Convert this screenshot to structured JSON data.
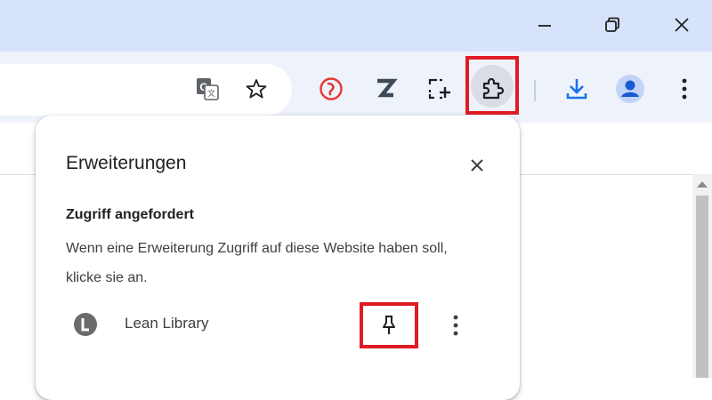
{
  "window": {
    "controls": [
      {
        "name": "minimize",
        "icon": "minimize-icon"
      },
      {
        "name": "restore",
        "icon": "restore-icon"
      },
      {
        "name": "close",
        "icon": "close-icon"
      }
    ]
  },
  "toolbar": {
    "icons": [
      "translate-icon",
      "bookmark-star-icon",
      "red-extension-icon",
      "z-extension-icon",
      "screenshot-extension-icon",
      "extensions-puzzle-icon",
      "download-icon",
      "profile-avatar-icon",
      "more-menu-icon"
    ]
  },
  "popup": {
    "title": "Erweiterungen",
    "section_heading": "Zugriff angefordert",
    "section_text": "Wenn eine Erweiterung Zugriff auf diese Website haben soll, klicke sie an.",
    "extensions": [
      {
        "name": "Lean Library",
        "icon": "lean-library-icon"
      }
    ]
  },
  "colors": {
    "titlebar": "#d7e3fb",
    "toolbar": "#eef2fa",
    "highlight_box": "#e01b24",
    "accent_blue": "#1a73e8",
    "ext_red": "#e53935"
  }
}
